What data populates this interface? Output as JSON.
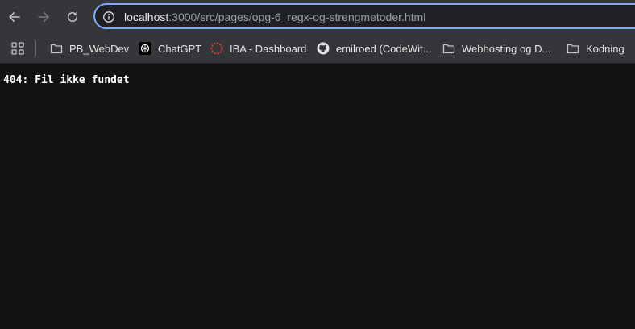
{
  "browser": {
    "url_host": "localhost",
    "url_rest": ":3000/src/pages/opg-6_regx-og-strengmetoder.html"
  },
  "bookmarks": [
    {
      "label": "PB_WebDev",
      "icon": "folder-icon"
    },
    {
      "label": "ChatGPT",
      "icon": "chatgpt-icon"
    },
    {
      "label": "IBA - Dashboard",
      "icon": "iba-icon"
    },
    {
      "label": "emilroed (CodeWit...",
      "icon": "github-icon"
    },
    {
      "label": "Webhosting og D...",
      "icon": "folder-icon"
    },
    {
      "label": "Kodning",
      "icon": "folder-icon"
    }
  ],
  "page": {
    "message": "404: Fil ikke fundet"
  },
  "colors": {
    "toolbar": "#35363a",
    "omnibox_border": "#7cacf8",
    "page_background": "#121212",
    "iba_red": "#e53935"
  }
}
